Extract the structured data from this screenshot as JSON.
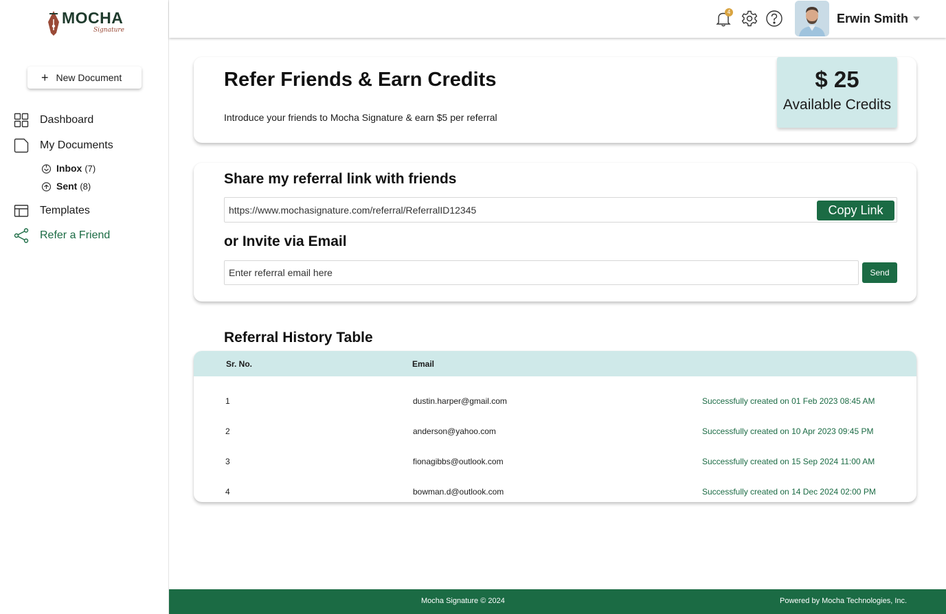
{
  "brand": {
    "name": "MOCHA",
    "tagline": "Signature"
  },
  "sidebar": {
    "new_document": "New Document",
    "items": [
      {
        "label": "Dashboard",
        "icon": "dashboard-icon"
      },
      {
        "label": "My Documents",
        "icon": "folder-icon"
      },
      {
        "label": "Templates",
        "icon": "templates-icon"
      },
      {
        "label": "Refer a Friend",
        "icon": "share-icon",
        "active": true
      }
    ],
    "sub_items": [
      {
        "label": "Inbox",
        "count": "(7)",
        "icon": "inbox-icon"
      },
      {
        "label": "Sent",
        "count": "(8)",
        "icon": "sent-icon"
      }
    ]
  },
  "topbar": {
    "notification_count": "4",
    "user_name": "Erwin Smith"
  },
  "refer_card": {
    "title": "Refer Friends & Earn Credits",
    "subtitle": "Introduce your friends to Mocha Signature & earn $5 per referral",
    "credits_amount": "$ 25",
    "credits_label": "Available Credits"
  },
  "share_card": {
    "title": "Share my referral link with friends",
    "link": "https://www.mochasignature.com/referral/ReferralID12345",
    "copy_label": "Copy Link",
    "invite_title": "or Invite via Email",
    "email_placeholder": "Enter referral email here",
    "send_label": "Send"
  },
  "history": {
    "title": "Referral History Table",
    "columns": [
      "Sr. No.",
      "Email"
    ],
    "rows": [
      {
        "no": "1",
        "email": "dustin.harper@gmail.com",
        "status": "Successfully created on 01 Feb 2023 08:45 AM"
      },
      {
        "no": "2",
        "email": "anderson@yahoo.com",
        "status": "Successfully created on 10 Apr 2023 09:45 PM"
      },
      {
        "no": "3",
        "email": "fionagibbs@outlook.com",
        "status": "Successfully created on 15 Sep 2024 11:00 AM"
      },
      {
        "no": "4",
        "email": "bowman.d@outlook.com",
        "status": "Successfully created on 14 Dec 2024 02:00 PM"
      }
    ]
  },
  "footer": {
    "copyright": "Mocha Signature © 2024",
    "powered": "Powered by Mocha Technologies, Inc."
  },
  "colors": {
    "accent": "#1b6b44",
    "highlight": "#cfe9e9",
    "badge": "#d9a441",
    "brand_brown": "#9a4a37"
  }
}
